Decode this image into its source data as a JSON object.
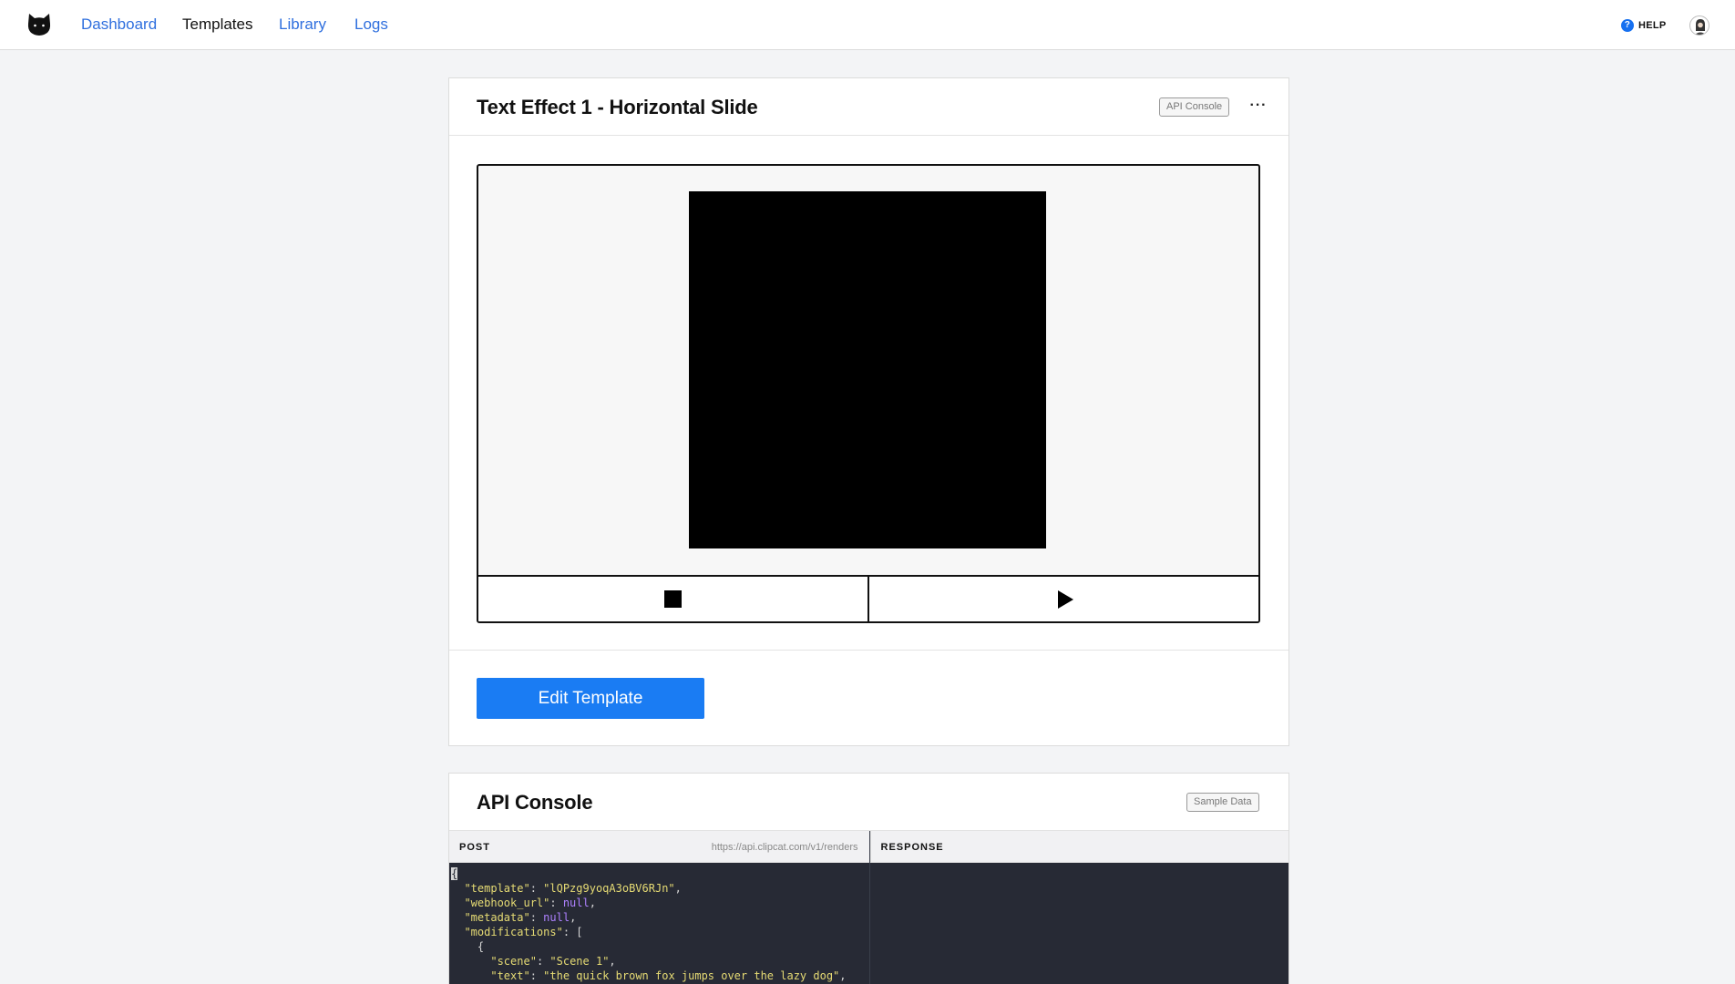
{
  "nav": {
    "links": [
      "Dashboard",
      "Templates",
      "Library",
      "Logs"
    ],
    "active": "Templates",
    "help_label": "HELP"
  },
  "template_card": {
    "title": "Text Effect 1 - Horizontal Slide",
    "api_console_button": "API Console",
    "more_label": "···",
    "edit_button": "Edit Template"
  },
  "api_console": {
    "title": "API Console",
    "sample_data_button": "Sample Data",
    "post_label": "POST",
    "endpoint": "https://api.clipcat.com/v1/renders",
    "response_label": "RESPONSE",
    "request_body": {
      "template": "lQPzg9yoqA3oBV6RJn",
      "webhook_url": "null",
      "metadata": "null",
      "modifications": [
        {
          "scene": "Scene 1",
          "text": "the quick brown fox jumps over the lazy dog"
        }
      ]
    }
  },
  "colors": {
    "link": "#2f6fde",
    "primary": "#1a7cf3",
    "help": "#1670f0",
    "code_bg": "#272a35",
    "code_string": "#e6db74",
    "code_null": "#ae81ff"
  }
}
